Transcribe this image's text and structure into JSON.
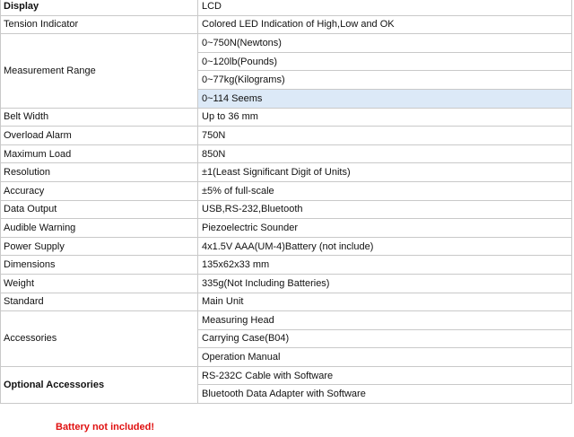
{
  "spec_rows": {
    "display": {
      "label": "Display",
      "value": "LCD"
    },
    "tension": {
      "label": "Tension Indicator",
      "value": "Colored LED Indication of High,Low and OK"
    },
    "range": {
      "label": "Measurement Range",
      "values": [
        "0~750N(Newtons)",
        "0~120lb(Pounds)",
        "0~77kg(Kilograms)",
        "0~114 Seems"
      ]
    },
    "belt": {
      "label": "Belt Width",
      "value": "Up to 36 mm"
    },
    "overload": {
      "label": "Overload Alarm",
      "value": "750N"
    },
    "maxload": {
      "label": "Maximum Load",
      "value": "850N"
    },
    "resolution": {
      "label": "Resolution",
      "value": "±1(Least Significant Digit of Units)"
    },
    "accuracy": {
      "label": "Accuracy",
      "value": "±5% of full-scale"
    },
    "output": {
      "label": "Data Output",
      "value": "USB,RS-232,Bluetooth"
    },
    "warning": {
      "label": "Audible Warning",
      "value": "Piezoelectric Sounder"
    },
    "power": {
      "label": "Power Supply",
      "value": "4x1.5V AAA(UM-4)Battery (not include)"
    },
    "dimensions": {
      "label": "Dimensions",
      "value": "135x62x33 mm"
    },
    "weight": {
      "label": "Weight",
      "value": "335g(Not Including Batteries)"
    },
    "standard": {
      "label": "Standard",
      "value": "Main Unit"
    },
    "accessories": {
      "label": "Accessories",
      "values": [
        "Measuring Head",
        "Carrying Case(B04)",
        "Operation Manual"
      ]
    },
    "optional": {
      "label": "Optional Accessories",
      "values": [
        "RS-232C Cable with Software",
        "Bluetooth Data Adapter with Software"
      ]
    }
  },
  "note": "Battery not included!"
}
